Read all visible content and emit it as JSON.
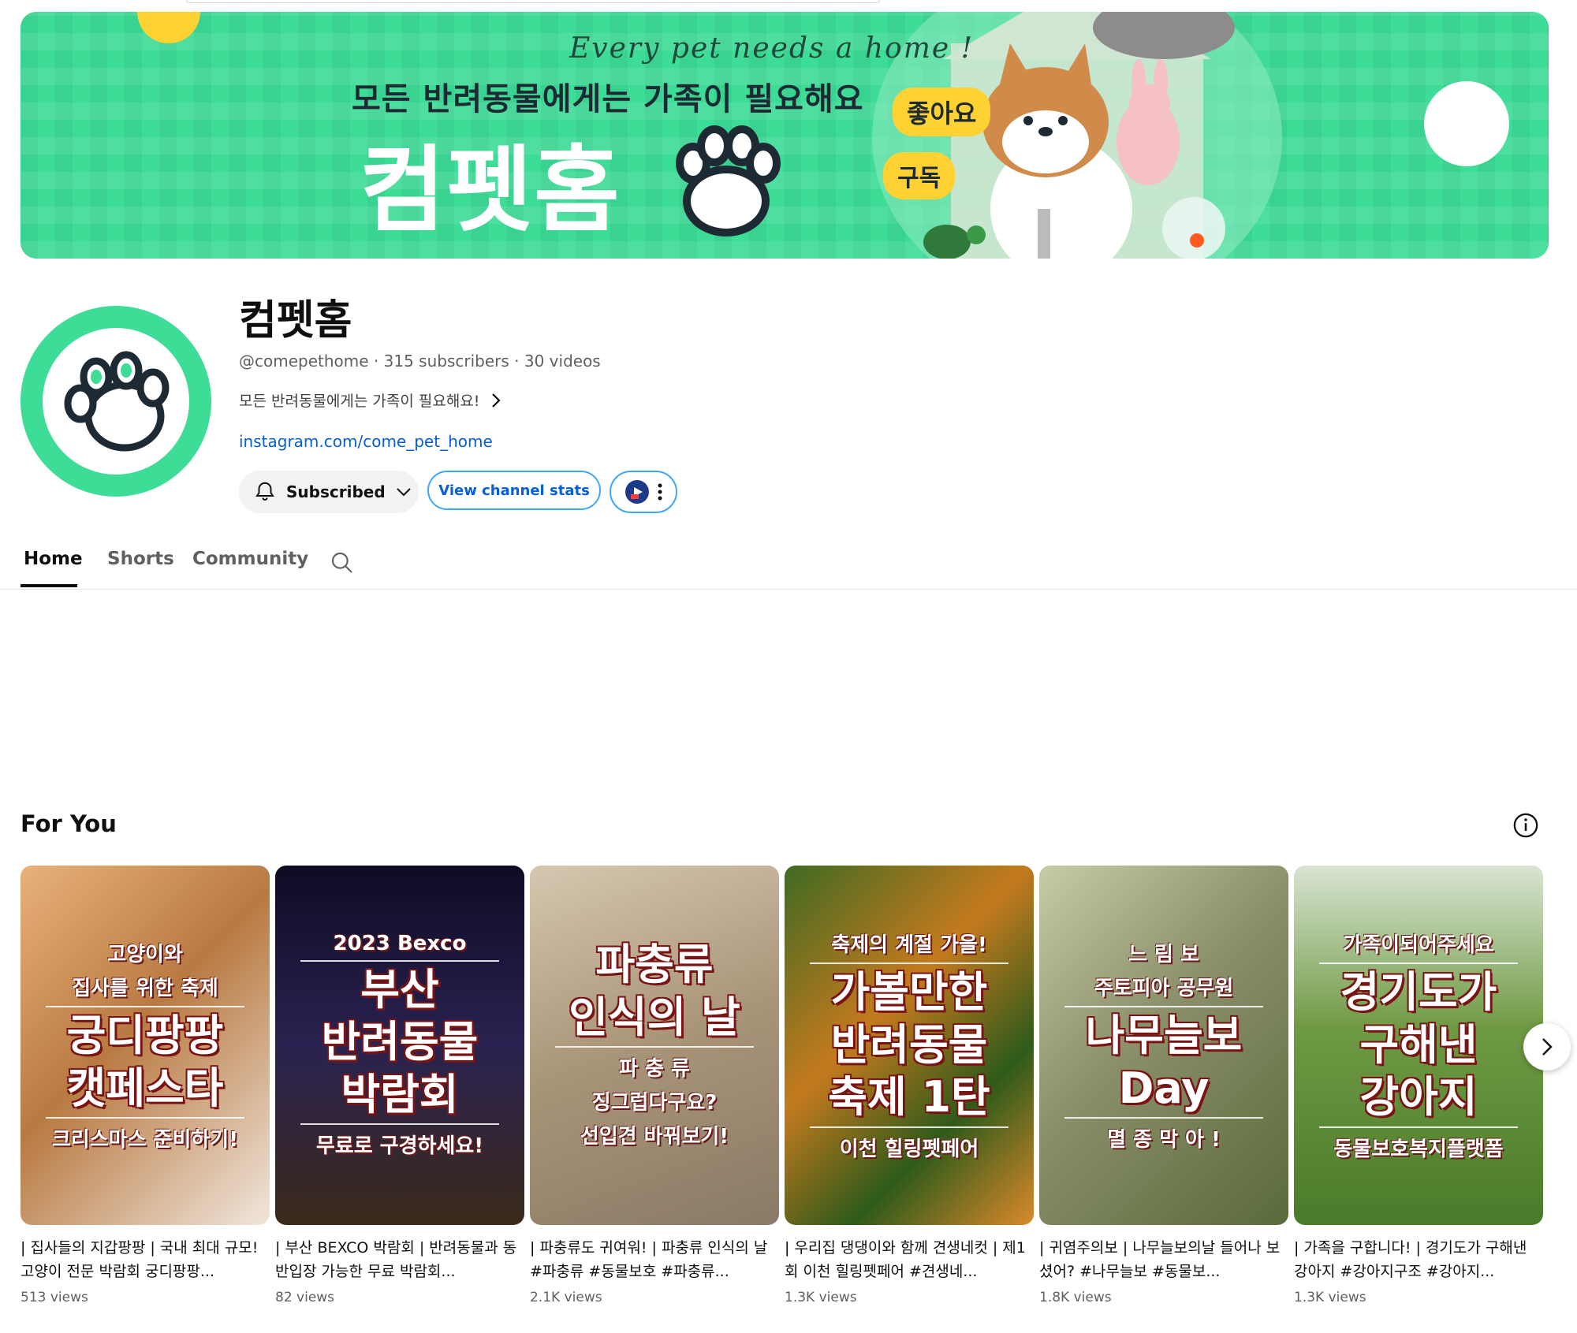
{
  "banner": {
    "tagline": "Every pet needs a home !",
    "subtitle": "모든 반려동물에게는 가족이 필요해요",
    "title": "컴펫홈",
    "bubble_like": "좋아요",
    "bubble_subscribe": "구독"
  },
  "channel": {
    "name": "컴펫홈",
    "meta": "@comepethome · 315 subscribers · 30 videos",
    "description": "모든 반려동물에게는 가족이 필요해요!",
    "link": "instagram.com/come_pet_home"
  },
  "actions": {
    "subscribed_label": "Subscribed",
    "stats_label": "View channel stats"
  },
  "tabs": [
    {
      "label": "Home",
      "active": true
    },
    {
      "label": "Shorts",
      "active": false
    },
    {
      "label": "Community",
      "active": false
    }
  ],
  "section": {
    "title": "For You"
  },
  "videos": [
    {
      "thumb_top": "고양이와",
      "thumb_top2": "집사를 위한 축제",
      "thumb_main1": "궁디팡팡",
      "thumb_main2": "캣페스타",
      "thumb_bottom": "크리스마스 준비하기!",
      "title": "| 집사들의 지갑팡팡 | 국내 최대 규모! 고양이 전문 박람회 궁디팡팡...",
      "views": "513 views",
      "bg": "#c98a4a"
    },
    {
      "thumb_top": "2023 Bexco",
      "thumb_main1": "부산",
      "thumb_main2": "반려동물",
      "thumb_main3": "박람회",
      "thumb_bottom": "무료로 구경하세요!",
      "title": "| 부산 BEXCO 박람회 | 반려동물과 동반입장 가능한 무료 박람회...",
      "views": "82 views",
      "bg": "#1a1633"
    },
    {
      "thumb_main1": "파충류",
      "thumb_main2": "인식의 날",
      "thumb_sub1": "파 충 류",
      "thumb_sub2": "징그럽다구요?",
      "thumb_bottom": "선입견 바꿔보기!",
      "title": "| 파충류도 귀여워! | 파충류 인식의 날 #파충류 #동물보호 #파충류...",
      "views": "2.1K views",
      "bg": "#b7a48a"
    },
    {
      "thumb_top": "축제의 계절 가을!",
      "thumb_main1": "가볼만한",
      "thumb_main2": "반려동물",
      "thumb_main3": "축제 1탄",
      "thumb_bottom": "이천 힐링펫페어",
      "title": "| 우리집 댕댕이와 함께 견생네컷 | 제1회 이천 힐링펫페어 #견생네...",
      "views": "1.3K views",
      "bg": "#5d7a2a"
    },
    {
      "thumb_top": "느 림 보",
      "thumb_top2": "주토피아 공무원",
      "thumb_main1": "나무늘보",
      "thumb_main2": "Day",
      "thumb_bottom": "멸 종 막 아 !",
      "title": "| 귀염주의보 | 나무늘보의날 들어나 보셨어? #나무늘보 #동물보...",
      "views": "1.8K views",
      "bg": "#8a8f6a"
    },
    {
      "thumb_top": "가족이되어주세요",
      "thumb_main1": "경기도가",
      "thumb_main2": "구해낸",
      "thumb_main3": "강아지",
      "thumb_bottom": "동물보호복지플랫폼",
      "title": "| 가족을 구합니다! | 경기도가 구해낸 강아지 #강아지구조 #강아지...",
      "views": "1.3K views",
      "bg": "#5a8a3a"
    }
  ],
  "colors": {
    "brand_green": "#3ddc97",
    "link_blue": "#065fd4",
    "outline_blue": "#3ea6ff"
  }
}
